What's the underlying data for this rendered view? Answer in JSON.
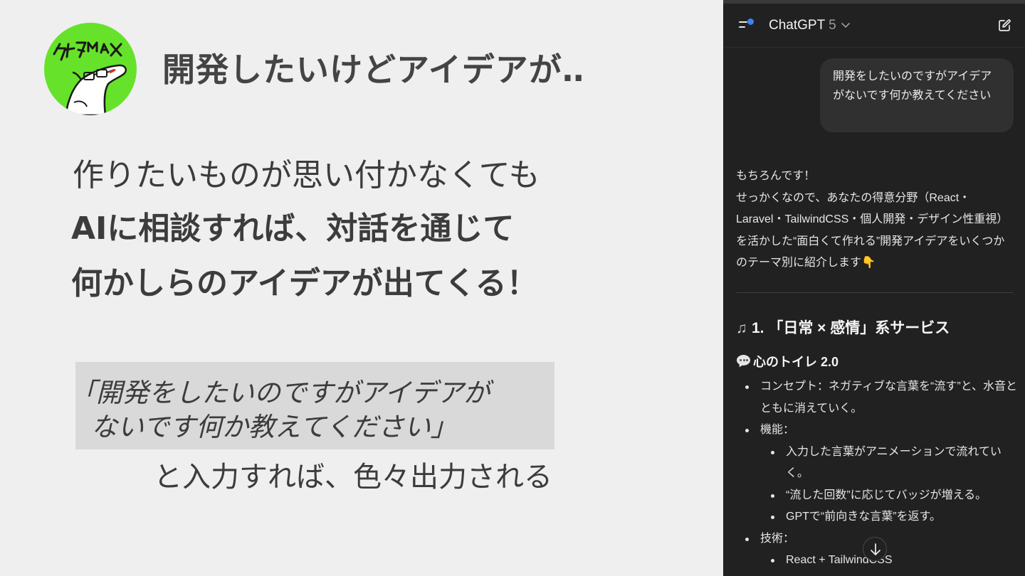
{
  "slide": {
    "title": "開発したいけどアイデアが‥",
    "line1": "作りたいものが思い付かなくても",
    "line2": "AIに相談すれば、対話を通じて",
    "line3": "何かしらのアイデアが出てくる！",
    "quote_line1": "「開発をしたいのですがアイデアが",
    "quote_line2": "ないです何か教えてください」",
    "after_quote": "と入力すれば、色々出力される",
    "logo_text": "ケイタMAX"
  },
  "chat": {
    "model_name": "ChatGPT",
    "model_version": "5",
    "user_message": "開発をしたいのですがアイデアがないです何か教えてください",
    "answer_intro": "もちろんです！",
    "answer_body": "せっかくなので、あなたの得意分野（React・Laravel・TailwindCSS・個人開発・デザイン性重視）を活かした“面白くて作れる”開発アイデアをいくつかのテーマ別に紹介します👇",
    "section_heading": "1. 「日常 × 感情」系サービス",
    "section_icon": "musical-note-icon",
    "item_heading": "心のトイレ 2.0",
    "item_icon": "speech-bubble-icon",
    "bullets": [
      {
        "level": 1,
        "text": "コンセプト：ネガティブな言葉を“流す”と、水音とともに消えていく。"
      },
      {
        "level": 1,
        "text": "機能："
      },
      {
        "level": 2,
        "text": "入力した言葉がアニメーションで流れていく。"
      },
      {
        "level": 2,
        "text": "“流した回数”に応じてバッジが増える。"
      },
      {
        "level": 2,
        "text": "GPTで“前向きな言葉”を返す。"
      },
      {
        "level": 1,
        "text": "技術："
      },
      {
        "level": 2,
        "text": "React + TailwindCSS"
      }
    ]
  },
  "colors": {
    "slide_bg": "#efefef",
    "panel_bg": "#212121",
    "bubble_bg": "#303030",
    "logo_green": "#66e22a",
    "accent_blue": "#3b82f6",
    "quote_bg": "#d9d9d9"
  }
}
